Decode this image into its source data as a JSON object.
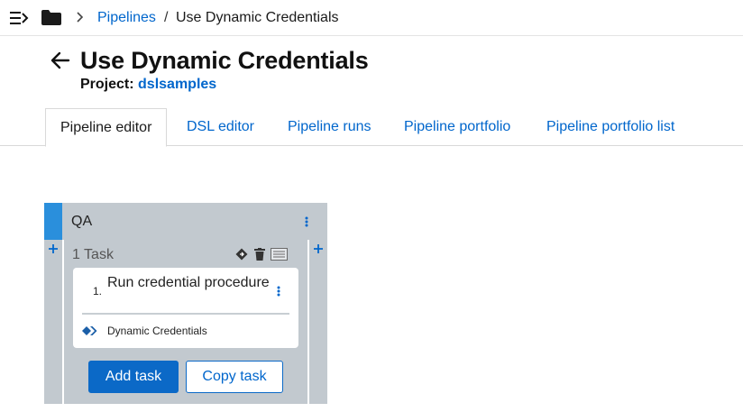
{
  "breadcrumb": {
    "parent_label": "Pipelines",
    "separator": "/",
    "current_label": "Use Dynamic Credentials"
  },
  "header": {
    "title": "Use Dynamic Credentials",
    "project_label": "Project:",
    "project_name": "dslsamples"
  },
  "tabs": [
    {
      "label": "Pipeline editor",
      "active": true
    },
    {
      "label": "DSL editor",
      "active": false
    },
    {
      "label": "Pipeline runs",
      "active": false
    },
    {
      "label": "Pipeline portfolio",
      "active": false
    },
    {
      "label": "Pipeline portfolio list",
      "active": false
    }
  ],
  "stage": {
    "name": "QA",
    "task_count": "1 Task",
    "tasks": [
      {
        "number": "1.",
        "name": "Run credential procedure",
        "plugin": "Dynamic Credentials"
      }
    ],
    "add_task_label": "Add task",
    "copy_task_label": "Copy task"
  },
  "colors": {
    "link": "#0066cc",
    "accent": "#2a8fdc",
    "stage_bg": "#c2c9cf",
    "primary_button": "#0b69c7"
  },
  "icons": [
    "menu-collapse-icon",
    "folder-icon",
    "chevron-right-icon",
    "arrow-left-icon",
    "kebab-icon",
    "plus-icon",
    "diamond-icon",
    "trash-icon",
    "list-icon",
    "plugin-logo-icon"
  ]
}
